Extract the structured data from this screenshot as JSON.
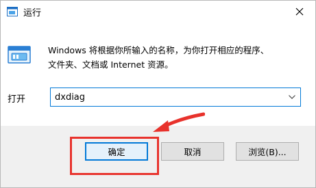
{
  "window": {
    "title": "运行"
  },
  "description": {
    "line1": "Windows 将根据你所输入的名称，为你打开相应的程序、",
    "line2": "文件夹、文档或 Internet 资源。"
  },
  "open": {
    "label": "打开",
    "value": "dxdiag"
  },
  "buttons": {
    "ok": "确定",
    "cancel": "取消",
    "browse": "浏览(B)..."
  },
  "colors": {
    "focus_accent": "#0078d7",
    "annotation_red": "#e8322c"
  },
  "icons": {
    "title": "run-app-icon",
    "close": "close-icon",
    "run": "run-program-icon",
    "dropdown": "chevron-down-icon"
  }
}
